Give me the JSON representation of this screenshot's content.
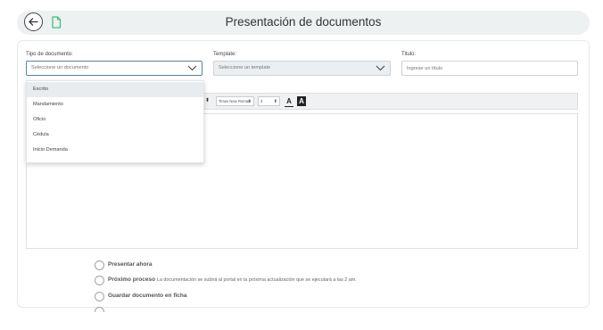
{
  "header": {
    "title": "Presentación de documentos"
  },
  "form": {
    "tipo": {
      "label": "Tipo de documento:",
      "placeholder": "Seleccione un documento"
    },
    "template": {
      "label": "Template:",
      "placeholder": "Seleccione un template"
    },
    "titulo": {
      "label": "Titulo:",
      "placeholder": "Ingrese un título"
    }
  },
  "dropdown": {
    "options": [
      {
        "label": "Escrito",
        "selected": true
      },
      {
        "label": "Mandamiento",
        "selected": false
      },
      {
        "label": "Oficio",
        "selected": false
      },
      {
        "label": "Cédula",
        "selected": false
      },
      {
        "label": "Inicio Demanda",
        "selected": false
      }
    ]
  },
  "toolbar": {
    "font": "Times New Roman",
    "size": "3",
    "text_color_icon": "A",
    "bg_color_icon": "A"
  },
  "options": {
    "presentar": {
      "label": "Presentar ahora"
    },
    "proximo": {
      "label": "Próximo proceso",
      "desc": "La documentación se subirá al portal en la próxima actualización que se ejecutará a las 2 am."
    },
    "guardar": {
      "label": "Guardar documento en ficha"
    }
  },
  "colors": {
    "header_bg": "#eef1f1",
    "doc_icon": "#3fbf7f",
    "active_border": "#5d7fa3"
  }
}
